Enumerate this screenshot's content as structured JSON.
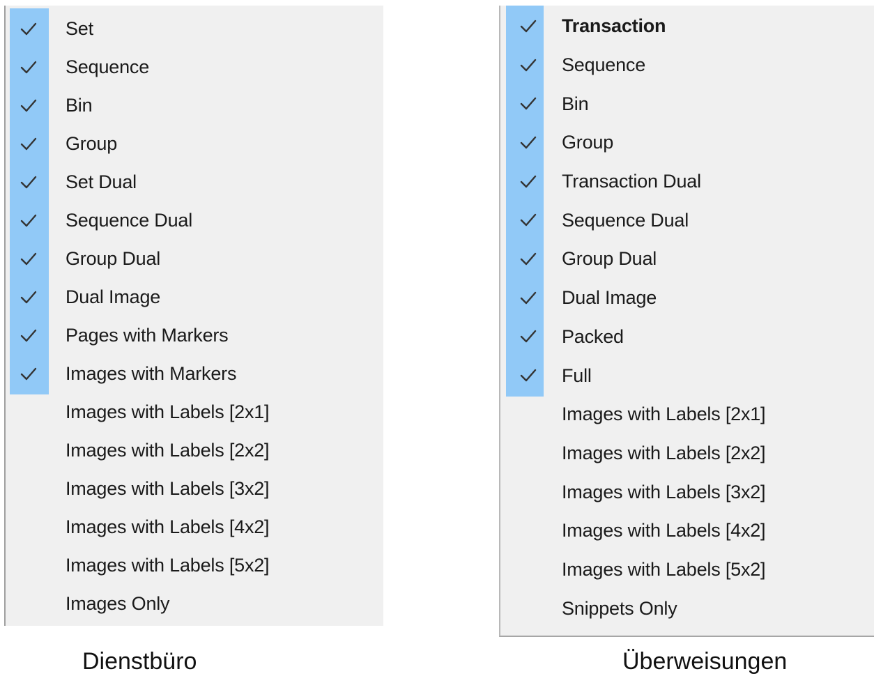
{
  "menus": [
    {
      "caption": "Dienstbüro",
      "items": [
        {
          "label": "Set",
          "checked": true,
          "bold": false
        },
        {
          "label": "Sequence",
          "checked": true,
          "bold": false
        },
        {
          "label": "Bin",
          "checked": true,
          "bold": false
        },
        {
          "label": "Group",
          "checked": true,
          "bold": false
        },
        {
          "label": "Set Dual",
          "checked": true,
          "bold": false
        },
        {
          "label": "Sequence Dual",
          "checked": true,
          "bold": false
        },
        {
          "label": "Group Dual",
          "checked": true,
          "bold": false
        },
        {
          "label": "Dual Image",
          "checked": true,
          "bold": false
        },
        {
          "label": "Pages with Markers",
          "checked": true,
          "bold": false
        },
        {
          "label": "Images with Markers",
          "checked": true,
          "bold": false
        },
        {
          "label": "Images with Labels [2x1]",
          "checked": false,
          "bold": false
        },
        {
          "label": "Images with Labels [2x2]",
          "checked": false,
          "bold": false
        },
        {
          "label": "Images with Labels [3x2]",
          "checked": false,
          "bold": false
        },
        {
          "label": "Images with Labels [4x2]",
          "checked": false,
          "bold": false
        },
        {
          "label": "Images with Labels [5x2]",
          "checked": false,
          "bold": false
        },
        {
          "label": "Images Only",
          "checked": false,
          "bold": false
        }
      ]
    },
    {
      "caption": "Überweisungen",
      "items": [
        {
          "label": "Transaction",
          "checked": true,
          "bold": true
        },
        {
          "label": "Sequence",
          "checked": true,
          "bold": false
        },
        {
          "label": "Bin",
          "checked": true,
          "bold": false
        },
        {
          "label": "Group",
          "checked": true,
          "bold": false
        },
        {
          "label": "Transaction Dual",
          "checked": true,
          "bold": false
        },
        {
          "label": "Sequence Dual",
          "checked": true,
          "bold": false
        },
        {
          "label": "Group Dual",
          "checked": true,
          "bold": false
        },
        {
          "label": "Dual Image",
          "checked": true,
          "bold": false
        },
        {
          "label": "Packed",
          "checked": true,
          "bold": false
        },
        {
          "label": "Full",
          "checked": true,
          "bold": false
        },
        {
          "label": "Images with Labels [2x1]",
          "checked": false,
          "bold": false
        },
        {
          "label": "Images with Labels [2x2]",
          "checked": false,
          "bold": false
        },
        {
          "label": "Images with Labels [3x2]",
          "checked": false,
          "bold": false
        },
        {
          "label": "Images with Labels [4x2]",
          "checked": false,
          "bold": false
        },
        {
          "label": "Images with Labels [5x2]",
          "checked": false,
          "bold": false
        },
        {
          "label": "Snippets Only",
          "checked": false,
          "bold": false
        }
      ]
    }
  ],
  "colors": {
    "menu_background": "#f0f0f0",
    "checked_highlight": "#91c9f7",
    "check_mark": "#333333",
    "text": "#1a1a1a"
  },
  "icons": {
    "check": "check-icon"
  }
}
